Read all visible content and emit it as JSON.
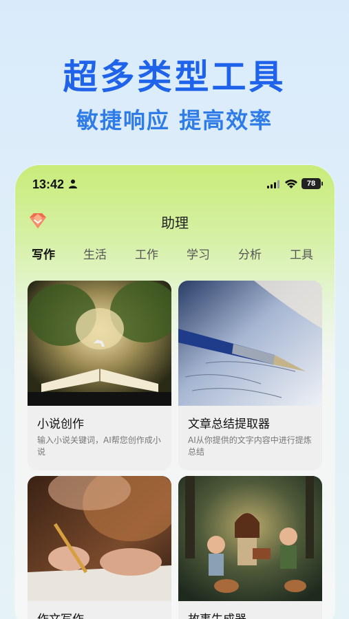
{
  "hero": {
    "title": "超多类型工具",
    "subtitle": "敏捷响应 提高效率"
  },
  "status_bar": {
    "time": "13:42",
    "battery": "78"
  },
  "header": {
    "title": "助理"
  },
  "tabs": [
    {
      "label": "写作"
    },
    {
      "label": "生活"
    },
    {
      "label": "工作"
    },
    {
      "label": "学习"
    },
    {
      "label": "分析"
    },
    {
      "label": "工具"
    }
  ],
  "cards": [
    {
      "title": "小说创作",
      "desc": "输入小说关键词，AI帮您创作成小说"
    },
    {
      "title": "文章总结提取器",
      "desc": "AI从你提供的文字内容中进行提炼总结"
    },
    {
      "title": "作文写作",
      "desc": ""
    },
    {
      "title": "故事生成器",
      "desc": ""
    }
  ],
  "colors": {
    "accent": "#1f63ea",
    "subtitle": "#2f7be8",
    "brand_gem": "#f06a4f"
  }
}
